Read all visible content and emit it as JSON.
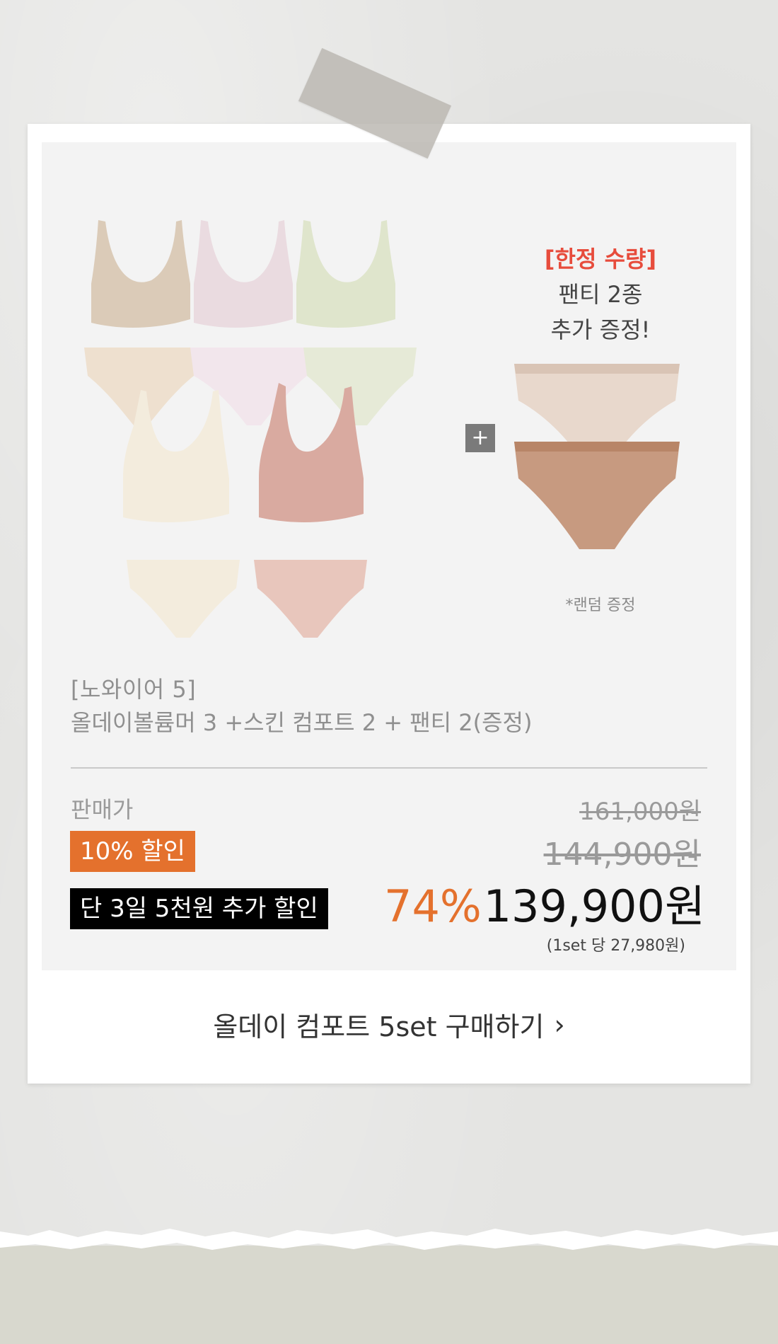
{
  "promo": {
    "limited": "[한정 수량]",
    "line1": "팬티 2종",
    "line2": "추가 증정!",
    "random_note": "*랜덤 증정"
  },
  "plus_sign": "+",
  "product": {
    "title_line1": "[노와이어 5]",
    "title_line2": "올데이볼륨머 3 +스킨 컴포트 2 + 팬티 2(증정)"
  },
  "pricing": {
    "label": "판매가",
    "original_price": "161,000원",
    "discount_badge": "10% 할인",
    "discounted_price": "144,900원",
    "extra_badge": "단 3일 5천원 추가 할인",
    "discount_percent": "74%",
    "final_price": "139,900원",
    "per_set": "(1set 당 27,980원)"
  },
  "cta": {
    "label": "올데이 컴포트 5set 구매하기",
    "chevron": "›"
  },
  "colors": {
    "accent_orange": "#e4712d",
    "limited_red": "#e74c3c",
    "badge_black": "#000000"
  }
}
